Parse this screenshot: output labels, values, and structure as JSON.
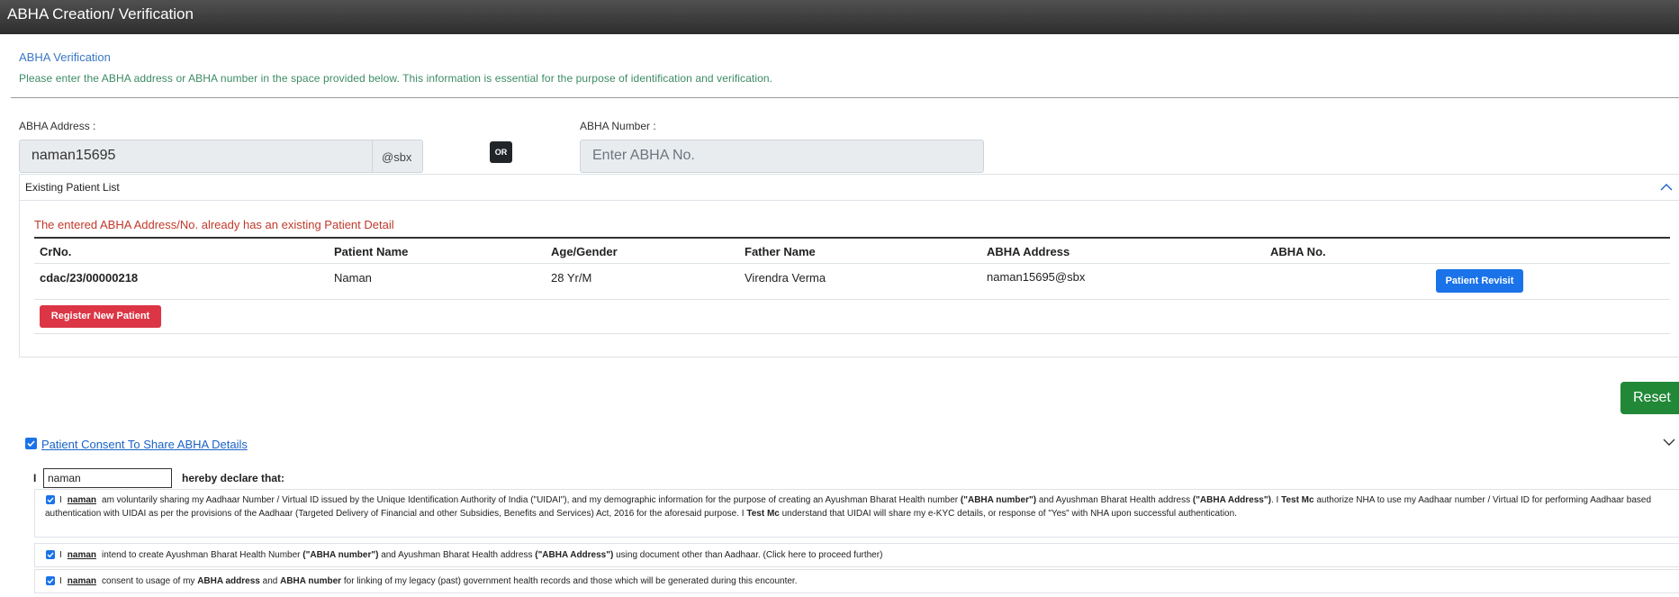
{
  "window": {
    "title": "ABHA Creation/ Verification"
  },
  "section": {
    "heading": "ABHA Verification",
    "description": "Please enter the ABHA address or ABHA number in the space provided below. This information is essential for the purpose of identification and verification."
  },
  "form": {
    "abha_address_label": "ABHA Address :",
    "abha_address_value": "naman15695",
    "abha_address_suffix": "@sbx",
    "or_label": "OR",
    "abha_number_label": "ABHA Number :",
    "abha_number_placeholder": "Enter ABHA No."
  },
  "patient_list": {
    "title": "Existing Patient List",
    "error": "The entered ABHA Address/No. already has an existing Patient Detail",
    "columns": [
      "CrNo.",
      "Patient Name",
      "Age/Gender",
      "Father Name",
      "ABHA Address",
      "ABHA No."
    ],
    "rows": [
      {
        "crno": "cdac/23/00000218",
        "name": "Naman",
        "age_gender": "28 Yr/M",
        "father": "Virendra Verma",
        "abha_address": "naman15695@sbx",
        "abha_no": "",
        "action": "Patient Revisit"
      }
    ],
    "register_button": "Register New Patient"
  },
  "reset_button": "Reset",
  "consent": {
    "link_label": "Patient Consent To Share ABHA Details",
    "prefix": "I",
    "name_value": "naman",
    "declare": "hereby declare that:",
    "clauses": [
      {
        "i": "I",
        "name": "naman",
        "t1": "am voluntarily sharing my Aadhaar Number / Virtual ID issued by the Unique Identification Authority of India (\"UIDAI\"), and my demographic information for the purpose of creating an Ayushman Bharat Health number",
        "b1": "(\"ABHA number\")",
        "t2": "and Ayushman Bharat Health address",
        "b2": "(\"ABHA Address\")",
        "t3": ". I",
        "b3": "Test Mc",
        "t4": "authorize NHA to use my Aadhaar number / Virtual ID for performing Aadhaar based authentication with UIDAI as per the provisions of the Aadhaar (Targeted Delivery of Financial and other Subsidies, Benefits and Services) Act, 2016 for the aforesaid purpose. I",
        "b4": "Test Mc",
        "t5": "understand that UIDAI will share my e-KYC details, or response of \"Yes\" with NHA upon successful authentication."
      },
      {
        "i": "I",
        "name": "naman",
        "t1": "intend to create Ayushman Bharat Health Number",
        "b1": "(\"ABHA number\")",
        "t2": "and Ayushman Bharat Health address",
        "b2": "(\"ABHA Address\")",
        "t3": "using document other than Aadhaar. (Click here to proceed further)"
      },
      {
        "i": "I",
        "name": "naman",
        "t1": "consent to usage of my",
        "b1": "ABHA address",
        "t2": "and",
        "b2": "ABHA number",
        "t3": "for linking of my legacy (past) government health records and those which will be generated during this encounter."
      }
    ]
  }
}
